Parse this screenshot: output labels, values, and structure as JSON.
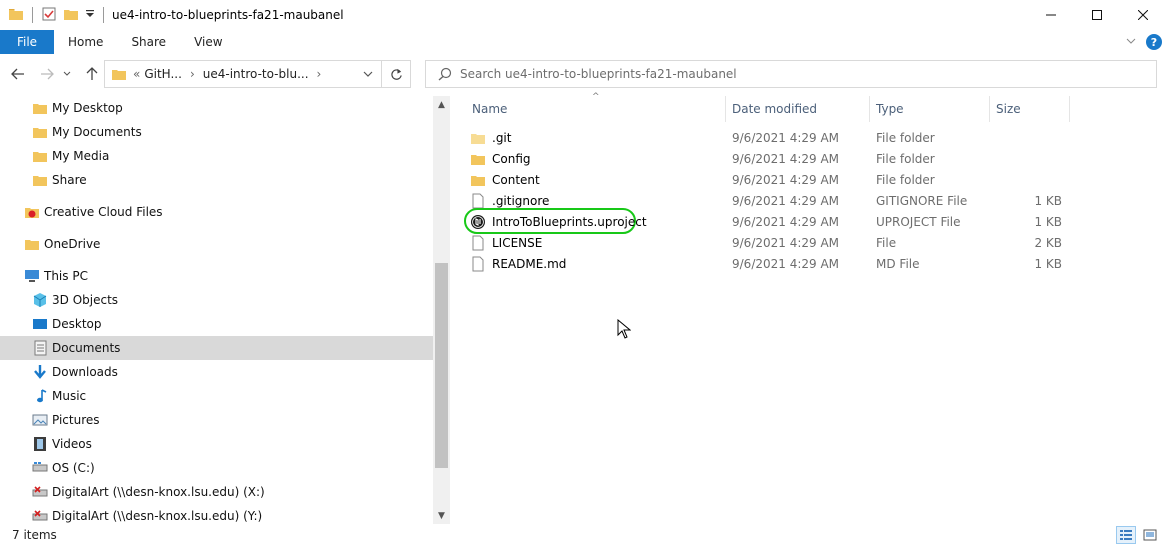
{
  "window": {
    "title": "ue4-intro-to-blueprints-fa21-maubanel"
  },
  "ribbon": {
    "tabs": [
      "File",
      "Home",
      "Share",
      "View"
    ]
  },
  "address": {
    "crumb_prefix": "«",
    "crumbs": [
      "GitH...",
      "ue4-intro-to-blu..."
    ],
    "search_placeholder": "Search ue4-intro-to-blueprints-fa21-maubanel"
  },
  "nav": {
    "items": [
      {
        "label": "My Desktop",
        "icon": "folder-icon"
      },
      {
        "label": "My Documents",
        "icon": "folder-icon"
      },
      {
        "label": "My Media",
        "icon": "folder-icon"
      },
      {
        "label": "Share",
        "icon": "folder-icon"
      },
      {
        "label": "Creative Cloud Files",
        "icon": "creative-cloud-icon"
      },
      {
        "label": "OneDrive",
        "icon": "folder-icon"
      },
      {
        "label": "This PC",
        "icon": "computer-icon"
      },
      {
        "label": "3D Objects",
        "icon": "cube-icon"
      },
      {
        "label": "Desktop",
        "icon": "desktop-icon"
      },
      {
        "label": "Documents",
        "icon": "documents-icon"
      },
      {
        "label": "Downloads",
        "icon": "download-arrow-icon"
      },
      {
        "label": "Music",
        "icon": "music-note-icon"
      },
      {
        "label": "Pictures",
        "icon": "pictures-icon"
      },
      {
        "label": "Videos",
        "icon": "film-icon"
      },
      {
        "label": "OS (C:)",
        "icon": "drive-icon"
      },
      {
        "label": "DigitalArt (\\\\desn-knox.lsu.edu) (X:)",
        "icon": "network-drive-icon"
      },
      {
        "label": "DigitalArt (\\\\desn-knox.lsu.edu) (Y:)",
        "icon": "network-drive-icon"
      }
    ],
    "selected": "Documents"
  },
  "files": {
    "columns": {
      "name": "Name",
      "date": "Date modified",
      "type": "Type",
      "size": "Size"
    },
    "rows": [
      {
        "name": ".git",
        "date": "9/6/2021 4:29 AM",
        "type": "File folder",
        "size": "",
        "icon": "folder-icon"
      },
      {
        "name": "Config",
        "date": "9/6/2021 4:29 AM",
        "type": "File folder",
        "size": "",
        "icon": "folder-icon"
      },
      {
        "name": "Content",
        "date": "9/6/2021 4:29 AM",
        "type": "File folder",
        "size": "",
        "icon": "folder-icon"
      },
      {
        "name": ".gitignore",
        "date": "9/6/2021 4:29 AM",
        "type": "GITIGNORE File",
        "size": "1 KB",
        "icon": "file-icon"
      },
      {
        "name": "IntroToBlueprints.uproject",
        "date": "9/6/2021 4:29 AM",
        "type": "UPROJECT File",
        "size": "1 KB",
        "icon": "unreal-logo-icon"
      },
      {
        "name": "LICENSE",
        "date": "9/6/2021 4:29 AM",
        "type": "File",
        "size": "2 KB",
        "icon": "file-icon"
      },
      {
        "name": "README.md",
        "date": "9/6/2021 4:29 AM",
        "type": "MD File",
        "size": "1 KB",
        "icon": "file-icon"
      }
    ]
  },
  "status": {
    "item_count": "7 items"
  },
  "colors": {
    "accent": "#1979ca",
    "highlight": "#18c818",
    "folder": "#f2c55c"
  }
}
